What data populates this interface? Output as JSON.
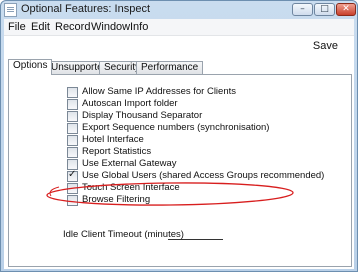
{
  "window": {
    "title": "Optional Features: Inspect",
    "minimize_glyph": "–",
    "maximize_glyph": "□",
    "close_glyph": "✕"
  },
  "menu": {
    "items": [
      "File",
      "Edit",
      "Record",
      "Window",
      "Info"
    ]
  },
  "toolbar": {
    "save_label": "Save"
  },
  "tabs": {
    "items": [
      "Options",
      "Unsupported",
      "Security",
      "Performance"
    ],
    "active": "Options"
  },
  "options": [
    {
      "label": "Allow Same IP Addresses for Clients",
      "checked": false
    },
    {
      "label": "Autoscan Import folder",
      "checked": false
    },
    {
      "label": "Display Thousand Separator",
      "checked": false
    },
    {
      "label": "Export Sequence numbers (synchronisation)",
      "checked": false
    },
    {
      "label": "Hotel Interface",
      "checked": false
    },
    {
      "label": "Report Statistics",
      "checked": false
    },
    {
      "label": "Use External Gateway",
      "checked": false
    },
    {
      "label": "Use Global Users (shared Access Groups recommended)",
      "checked": true
    },
    {
      "label": "Touch Screen Interface",
      "checked": false
    },
    {
      "label": "Browse Filtering",
      "checked": false
    }
  ],
  "idle_timeout": {
    "label": "Idle Client Timeout (minutes)",
    "value": ""
  },
  "colors": {
    "highlight_ring": "#d81e1e",
    "titlebar": "#c9dcef",
    "close_button": "#c8402c"
  },
  "icons": [
    "app-window-icon",
    "minimize-icon",
    "maximize-icon",
    "close-icon",
    "checkmark-icon"
  ]
}
